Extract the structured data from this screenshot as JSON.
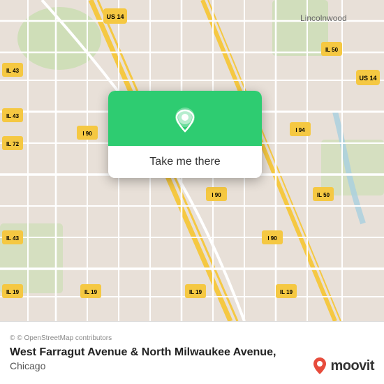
{
  "map": {
    "background_color": "#e8e0d8",
    "attribution": "© OpenStreetMap contributors"
  },
  "popup": {
    "button_label": "Take me there",
    "pin_icon": "location-pin"
  },
  "bottom_bar": {
    "location_name": "West Farragut Avenue & North Milwaukee Avenue,",
    "city": "Chicago",
    "attribution": "© OpenStreetMap contributors"
  },
  "moovit": {
    "text": "moovit"
  },
  "road_labels": {
    "us14_top": "US 14",
    "il43_left": "IL 43",
    "il43_mid": "IL 43",
    "il72": "IL 72",
    "i90_left": "I 90",
    "i90_mid": "I 90",
    "i90_right": "I 90",
    "i94": "I 94",
    "il50_top": "IL 50",
    "il50_mid": "IL 50",
    "us14_right": "US 14",
    "il43_bottom": "IL 43",
    "il19_1": "IL 19",
    "il19_2": "IL 19",
    "il19_3": "IL 19",
    "il19_4": "IL 19",
    "lincolnwood": "Lincolnwood"
  }
}
